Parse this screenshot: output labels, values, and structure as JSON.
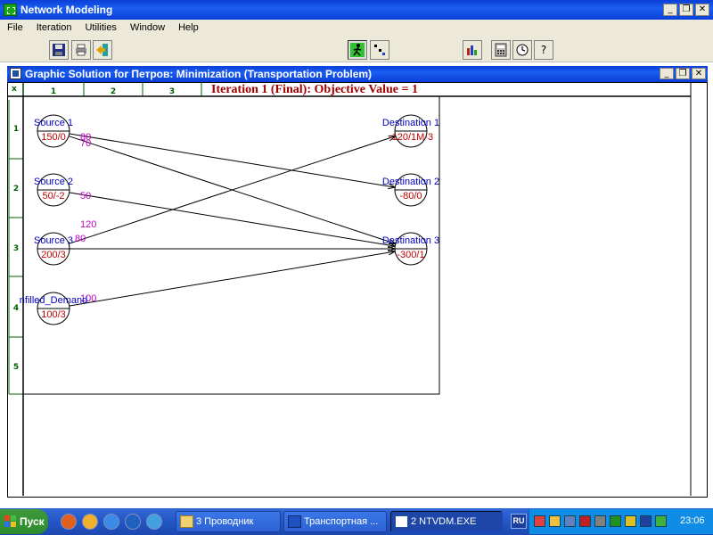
{
  "window": {
    "title": "Network Modeling",
    "minimize": "_",
    "restore": "❐",
    "close": "✕"
  },
  "menu": [
    "File",
    "Iteration",
    "Utilities",
    "Window",
    "Help"
  ],
  "child_window": {
    "title": "Graphic Solution for Петров: Minimization (Transportation Problem)",
    "minimize": "_",
    "restore": "❐",
    "close": "✕"
  },
  "sheet": {
    "page_marker": "x",
    "col_headers": [
      "1",
      "2",
      "3"
    ],
    "row_headers": [
      "1",
      "2",
      "3",
      "4",
      "5"
    ]
  },
  "iteration_title": "Iteration 1 (Final): Objective Value = 1",
  "nodes": {
    "sources": [
      {
        "name": "Source 1",
        "value": "150/0"
      },
      {
        "name": "Source 2",
        "value": "50/-2"
      },
      {
        "name": "Source 3",
        "value": "200/3"
      },
      {
        "name": "nfilled_Demand",
        "value": "100/3"
      }
    ],
    "destinations": [
      {
        "name": "Destination 1",
        "value": "-120/1M-3"
      },
      {
        "name": "Destination 2",
        "value": "-80/0"
      },
      {
        "name": "Destination 3",
        "value": "-300/1"
      }
    ]
  },
  "flows": [
    {
      "from": 0,
      "to": 1,
      "label": "80"
    },
    {
      "from": 0,
      "to": 2,
      "label": "70"
    },
    {
      "from": 1,
      "to": 2,
      "label": "50"
    },
    {
      "from": 2,
      "to": 0,
      "label": "120"
    },
    {
      "from": 2,
      "to": 2,
      "label": "80"
    },
    {
      "from": 3,
      "to": 2,
      "label": "100"
    }
  ],
  "colors": {
    "node_name": "#0000c0",
    "node_value": "#c00000",
    "flow_label": "#c000c0",
    "title_bar": "#0a3ed8",
    "iteration_title": "#a00000"
  },
  "taskbar": {
    "start": "Пуск",
    "tasks": [
      {
        "label": "3 Проводник",
        "active": false
      },
      {
        "label": "Транспортная ...",
        "active": false
      },
      {
        "label": "2 NTVDM.EXE",
        "active": true
      }
    ],
    "lang": "RU",
    "clock": "23:06"
  }
}
